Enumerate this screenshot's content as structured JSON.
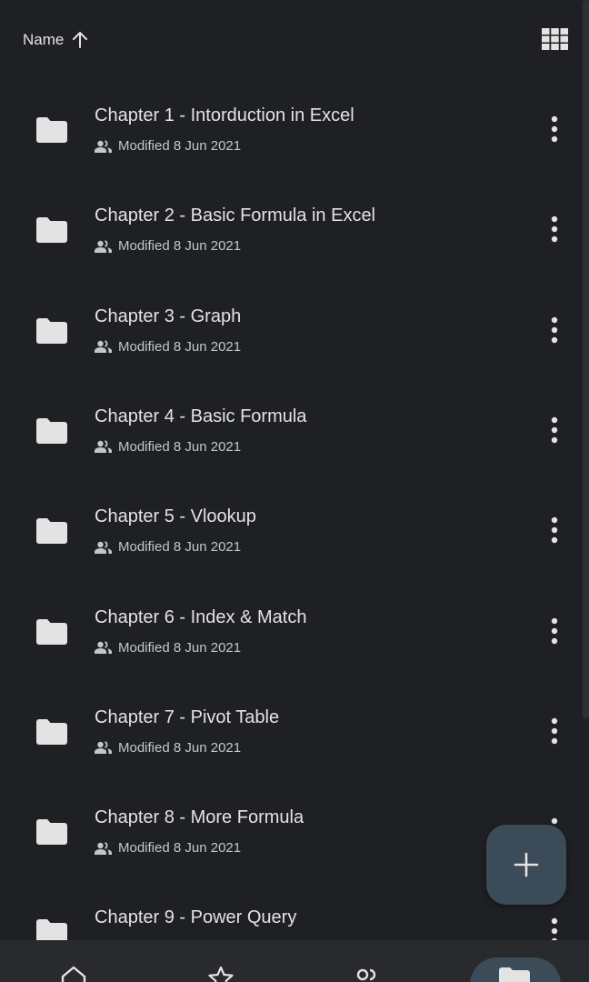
{
  "sort": {
    "label": "Name",
    "direction_icon": "arrow-up-icon"
  },
  "view_toggle_icon": "grid-view-icon",
  "files": [
    {
      "title": "Chapter 1 - Intorduction in Excel",
      "modified": "Modified 8 Jun 2021",
      "icon": "folder-icon",
      "shared": true
    },
    {
      "title": "Chapter 2 - Basic Formula in Excel",
      "modified": "Modified 8 Jun 2021",
      "icon": "folder-icon",
      "shared": true
    },
    {
      "title": "Chapter 3 - Graph",
      "modified": "Modified 8 Jun 2021",
      "icon": "folder-icon",
      "shared": true
    },
    {
      "title": "Chapter 4 - Basic Formula",
      "modified": "Modified 8 Jun 2021",
      "icon": "folder-icon",
      "shared": true
    },
    {
      "title": "Chapter 5 - Vlookup",
      "modified": "Modified 8 Jun 2021",
      "icon": "folder-icon",
      "shared": true
    },
    {
      "title": "Chapter 6 - Index & Match",
      "modified": "Modified 8 Jun 2021",
      "icon": "folder-icon",
      "shared": true
    },
    {
      "title": "Chapter 7 - Pivot Table",
      "modified": "Modified 8 Jun 2021",
      "icon": "folder-icon",
      "shared": true
    },
    {
      "title": "Chapter 8 - More Formula",
      "modified": "Modified 8 Jun 2021",
      "icon": "folder-icon",
      "shared": true
    },
    {
      "title": "Chapter 9 - Power Query",
      "modified": "",
      "icon": "folder-icon",
      "shared": true
    }
  ],
  "fab_icon": "plus-icon",
  "bottom_nav": [
    {
      "icon": "home-icon"
    },
    {
      "icon": "star-icon"
    },
    {
      "icon": "shared-icon"
    },
    {
      "icon": "folder-icon",
      "active": true
    }
  ],
  "colors": {
    "background": "#1e2023",
    "text_primary": "#e3e3e3",
    "text_secondary": "#c4c7c5",
    "fab": "#3c4b58",
    "nav_background": "#282a2e"
  }
}
